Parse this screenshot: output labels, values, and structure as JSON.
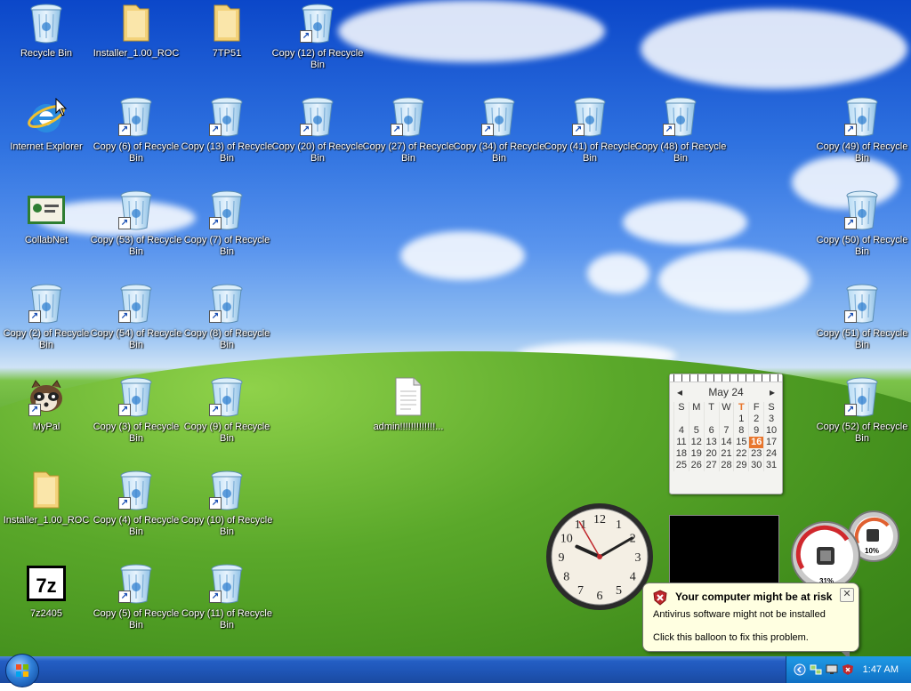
{
  "desktop_icons": [
    {
      "name": "desktop-icon-recycle-bin",
      "type": "bin",
      "label": "Recycle Bin",
      "shortcut": false
    },
    {
      "name": "desktop-icon-installer-folder-1",
      "type": "folder",
      "label": "Installer_1.00_ROC",
      "shortcut": false
    },
    {
      "name": "desktop-icon-7tp51",
      "type": "folder",
      "label": "7TP51",
      "shortcut": false
    },
    {
      "name": "desktop-icon-copy-12",
      "type": "bin",
      "label": "Copy (12) of Recycle Bin",
      "shortcut": true
    },
    {
      "name": "desktop-icon-internet-explorer",
      "type": "ie",
      "label": "Internet Explorer",
      "shortcut": false
    },
    {
      "name": "desktop-icon-copy-6",
      "type": "bin",
      "label": "Copy (6) of Recycle Bin",
      "shortcut": true
    },
    {
      "name": "desktop-icon-copy-13",
      "type": "bin",
      "label": "Copy (13) of Recycle Bin",
      "shortcut": true
    },
    {
      "name": "desktop-icon-copy-20",
      "type": "bin",
      "label": "Copy (20) of Recycle Bin",
      "shortcut": true
    },
    {
      "name": "desktop-icon-copy-27",
      "type": "bin",
      "label": "Copy (27) of Recycle Bin",
      "shortcut": true
    },
    {
      "name": "desktop-icon-copy-34",
      "type": "bin",
      "label": "Copy (34) of Recycle Bin",
      "shortcut": true
    },
    {
      "name": "desktop-icon-copy-41",
      "type": "bin",
      "label": "Copy (41) of Recycle Bin",
      "shortcut": true
    },
    {
      "name": "desktop-icon-copy-48",
      "type": "bin",
      "label": "Copy (48) of Recycle Bin",
      "shortcut": true
    },
    {
      "name": "desktop-icon-copy-49",
      "type": "bin",
      "label": "Copy (49) of Recycle Bin",
      "shortcut": true
    },
    {
      "name": "desktop-icon-collabnet",
      "type": "collabnet",
      "label": "CollabNet",
      "shortcut": false
    },
    {
      "name": "desktop-icon-copy-53",
      "type": "bin",
      "label": "Copy (53) of Recycle Bin",
      "shortcut": true
    },
    {
      "name": "desktop-icon-copy-7",
      "type": "bin",
      "label": "Copy (7) of Recycle Bin",
      "shortcut": true
    },
    {
      "name": "desktop-icon-copy-50",
      "type": "bin",
      "label": "Copy (50) of Recycle Bin",
      "shortcut": true
    },
    {
      "name": "desktop-icon-copy-2",
      "type": "bin",
      "label": "Copy (2) of Recycle Bin",
      "shortcut": true
    },
    {
      "name": "desktop-icon-copy-54",
      "type": "bin",
      "label": "Copy (54) of Recycle Bin",
      "shortcut": true
    },
    {
      "name": "desktop-icon-copy-8",
      "type": "bin",
      "label": "Copy (8) of Recycle Bin",
      "shortcut": true
    },
    {
      "name": "desktop-icon-copy-51",
      "type": "bin",
      "label": "Copy (51) of Recycle Bin",
      "shortcut": true
    },
    {
      "name": "desktop-icon-mypal",
      "type": "mypal",
      "label": "MyPal",
      "shortcut": true
    },
    {
      "name": "desktop-icon-copy-3",
      "type": "bin",
      "label": "Copy (3) of Recycle Bin",
      "shortcut": true
    },
    {
      "name": "desktop-icon-copy-9",
      "type": "bin",
      "label": "Copy (9) of Recycle Bin",
      "shortcut": true
    },
    {
      "name": "desktop-icon-admin-file",
      "type": "file",
      "label": "admin!!!!!!!!!!!!!...",
      "shortcut": false
    },
    {
      "name": "desktop-icon-copy-52",
      "type": "bin",
      "label": "Copy (52) of Recycle Bin",
      "shortcut": true
    },
    {
      "name": "desktop-icon-installer-folder-2",
      "type": "folder",
      "label": "Installer_1.00_ROC",
      "shortcut": false
    },
    {
      "name": "desktop-icon-copy-4",
      "type": "bin",
      "label": "Copy (4) of Recycle Bin",
      "shortcut": true
    },
    {
      "name": "desktop-icon-copy-10",
      "type": "bin",
      "label": "Copy (10) of Recycle Bin",
      "shortcut": true
    },
    {
      "name": "desktop-icon-7z2405",
      "type": "7z",
      "label": "7z2405",
      "shortcut": false
    },
    {
      "name": "desktop-icon-copy-5",
      "type": "bin",
      "label": "Copy (5) of Recycle Bin",
      "shortcut": true
    },
    {
      "name": "desktop-icon-copy-11",
      "type": "bin",
      "label": "Copy (11) of Recycle Bin",
      "shortcut": true
    }
  ],
  "calendar": {
    "month_label": "May 24",
    "prev_glyph": "◂",
    "next_glyph": "▸",
    "weekdays": [
      "S",
      "M",
      "T",
      "W",
      "T",
      "F",
      "S"
    ],
    "today_weekday_index": 4,
    "cells": [
      "",
      "",
      "",
      "",
      "1",
      "2",
      "3",
      "4",
      "5",
      "6",
      "7",
      "8",
      "9",
      "10",
      "11",
      "12",
      "13",
      "14",
      "15",
      "16",
      "17",
      "18",
      "19",
      "20",
      "21",
      "22",
      "23",
      "24",
      "25",
      "26",
      "27",
      "28",
      "29",
      "30",
      "31",
      ""
    ],
    "today": "16"
  },
  "clock": {
    "hours": [
      "12",
      "1",
      "2",
      "3",
      "4",
      "5",
      "6",
      "7",
      "8",
      "9",
      "10",
      "11"
    ],
    "hour_hand_hour": 9.8,
    "minute_hand_minute": 10,
    "second_hand_second": 55
  },
  "meter": {
    "cpu_percent_label": "10%",
    "ram_percent_label": "31%"
  },
  "balloon": {
    "title": "Your computer might be at risk",
    "line1": "Antivirus software might not be installed",
    "line2": "Click this balloon to fix this problem.",
    "close_glyph": "✕"
  },
  "taskbar": {
    "time": "1:47 AM"
  },
  "colors": {
    "accent": "#1e54b4",
    "balloon_bg": "#ffffe1",
    "calendar_today": "#e8762d",
    "warning_red": "#c0282d"
  }
}
